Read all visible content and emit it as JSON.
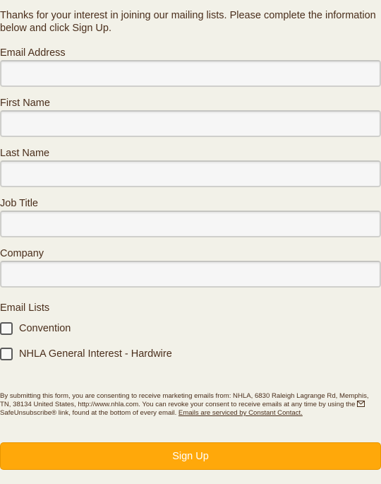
{
  "form": {
    "intro": "Thanks for your interest in joining our mailing lists. Please complete the information below and click Sign Up.",
    "fields": [
      {
        "label": "Email Address",
        "value": "",
        "placeholder": ""
      },
      {
        "label": "First Name",
        "value": "",
        "placeholder": ""
      },
      {
        "label": "Last Name",
        "value": "",
        "placeholder": ""
      },
      {
        "label": "Job Title",
        "value": "",
        "placeholder": ""
      },
      {
        "label": "Company",
        "value": "",
        "placeholder": ""
      }
    ],
    "email_lists": {
      "label": "Email Lists",
      "items": [
        {
          "label": "Convention",
          "checked": false
        },
        {
          "label": "NHLA General Interest - Hardwire",
          "checked": false
        }
      ]
    },
    "disclaimer": {
      "text": "By submitting this form, you are consenting to receive marketing emails from: NHLA, 6830 Raleigh Lagrange Rd, Memphis, TN, 38134 United States, http://www.nhla.com. You can revoke your consent to receive emails at any time by using the",
      "safeunsubscribe": "SafeUnsubscribe® link, found at the bottom of every email.",
      "service_link": "Emails are serviced by Constant Contact."
    },
    "submit_label": "Sign Up"
  },
  "colors": {
    "background": "#f2f1e8",
    "text": "#4a2e1b",
    "button": "#ffa80a"
  }
}
